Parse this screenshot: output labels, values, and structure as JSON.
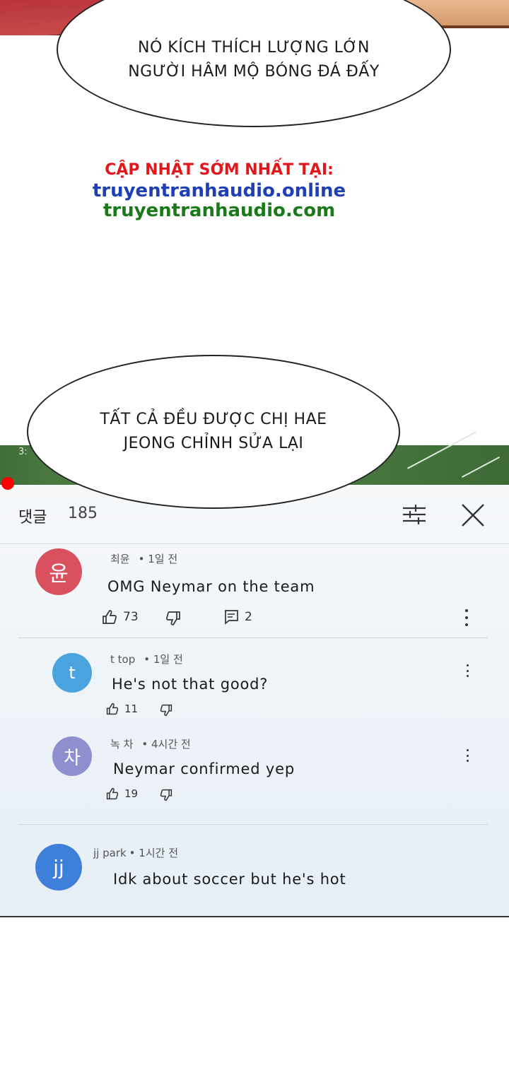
{
  "bubbles": {
    "top": {
      "line1": "NÓ KÍCH THÍCH LƯỢNG LỚN",
      "line2": "NGƯỜI HÂM MỘ BÓNG ĐÁ ĐẤY"
    },
    "bottom": {
      "line1": "TẤT CẢ ĐỀU ĐƯỢC CHỊ HAE",
      "line2": "JEONG CHỈNH SỬA LẠI"
    }
  },
  "promo": {
    "line1": "CẬP NHẬT SỚM NHẤT TẠI:",
    "line2": "truyentranhaudio.online",
    "line3": "truyentranhaudio.com"
  },
  "video": {
    "time_partial": "3:"
  },
  "comments_panel": {
    "title": "댓글",
    "count": "185",
    "filter_icon": "sliders-icon",
    "close_icon": "close-icon"
  },
  "comments": [
    {
      "avatar": "윤",
      "avatar_color": "#d9505e",
      "author": "최윤",
      "time": "• 1일 전",
      "text": "OMG Neymar on the team",
      "likes": "73",
      "replies": "2"
    },
    {
      "avatar": "t",
      "avatar_color": "#4aa3df",
      "author": "t top",
      "time": "• 1일 전",
      "text": "He's not that good?",
      "likes": "11"
    },
    {
      "avatar": "차",
      "avatar_color": "#8f8fd0",
      "author": "녹 차",
      "time": "• 4시간 전",
      "text": "Neymar confirmed yep",
      "likes": "19"
    },
    {
      "avatar": "jj",
      "avatar_color": "#3d7fd9",
      "author": "jj park",
      "time": "• 1시간 전",
      "text": "Idk about soccer but he's hot"
    }
  ],
  "colors": {
    "promo_red": "#e1171c",
    "promo_blue": "#1f3fb5",
    "promo_green": "#1a7a1a",
    "progress_red": "#ff0000"
  }
}
